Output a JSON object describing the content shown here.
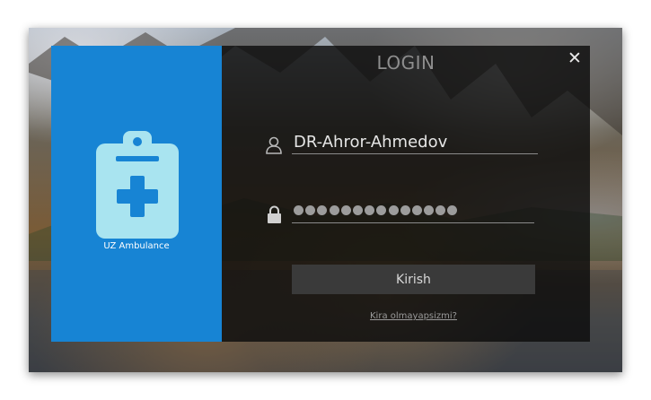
{
  "window": {
    "title": "LOGIN",
    "close_glyph": "✕"
  },
  "brand": {
    "name": "UZ Ambulance",
    "logo_icon": "medical-clipboard-icon",
    "panel_color": "#1784d4"
  },
  "form": {
    "username_value": "DR-Ahror-Ahmedov",
    "username_icon": "user-icon",
    "password_masked_length": 14,
    "password_icon": "lock-icon",
    "submit_label": "Kirish",
    "forgot_link": "Kira olmayapsizmi?"
  },
  "colors": {
    "accent": "#1784d4",
    "panel_bg": "#0c0c0c",
    "button_bg": "#3a3a3a"
  }
}
